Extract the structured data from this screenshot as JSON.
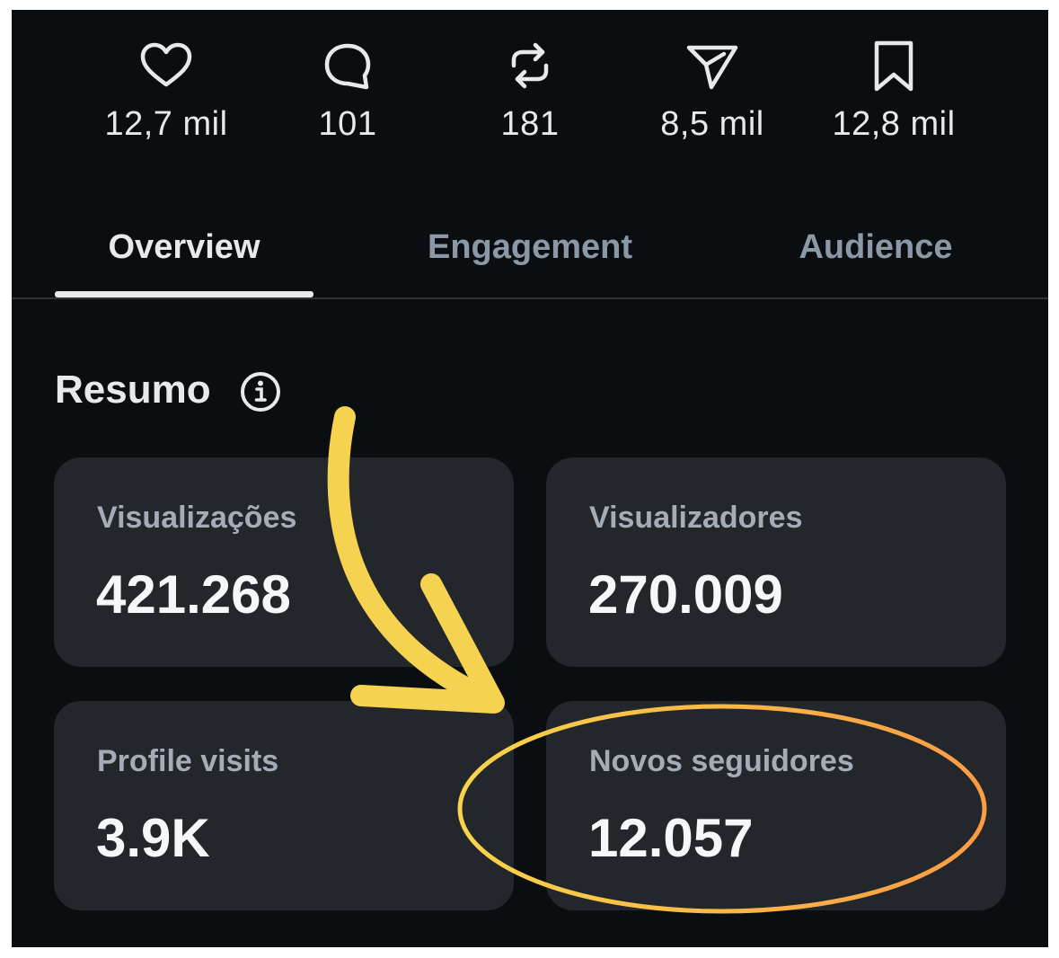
{
  "stats": [
    {
      "icon": "heart-icon",
      "value": "12,7 mil"
    },
    {
      "icon": "reply-icon",
      "value": "101"
    },
    {
      "icon": "repost-icon",
      "value": "181"
    },
    {
      "icon": "send-icon",
      "value": "8,5 mil"
    },
    {
      "icon": "bookmark-icon",
      "value": "12,8 mil"
    }
  ],
  "tabs": [
    {
      "label": "Overview",
      "active": true
    },
    {
      "label": "Engagement",
      "active": false
    },
    {
      "label": "Audience",
      "active": false
    }
  ],
  "summary": {
    "title": "Resumo",
    "info_icon": "info-icon",
    "cards": [
      {
        "label": "Visualizações",
        "value": "421.268"
      },
      {
        "label": "Visualizadores",
        "value": "270.009"
      },
      {
        "label": "Profile visits",
        "value": "3.9K"
      },
      {
        "label": "Novos seguidores",
        "value": "12.057"
      }
    ]
  },
  "annotation": {
    "arrow_color": "#f5d24f",
    "ellipse_gradient": [
      "#f7d44a",
      "#fb9b45"
    ]
  }
}
